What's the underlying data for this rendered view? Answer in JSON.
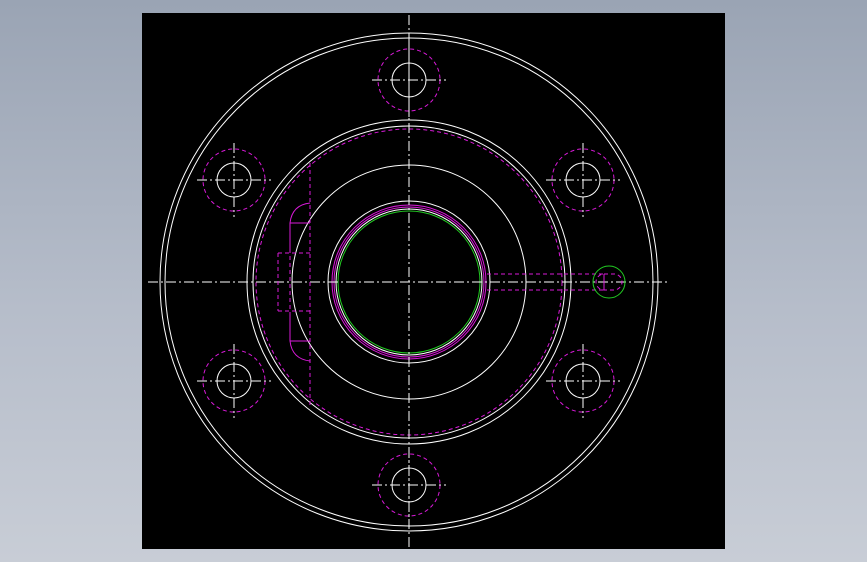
{
  "viewport": {
    "name": "cad-drawing-viewport",
    "background": "#000000"
  },
  "colors": {
    "outline": "#ffffff",
    "hidden_line": "#d81ad8",
    "centerline": "#ffffff",
    "bore": "#22cc22",
    "thread_circle": "#22cc22"
  },
  "drawing": {
    "view": "flange-end-view",
    "bolt_hole_count": 6,
    "line_types": [
      "continuous",
      "dashed-hidden",
      "dash-dot-center"
    ]
  }
}
